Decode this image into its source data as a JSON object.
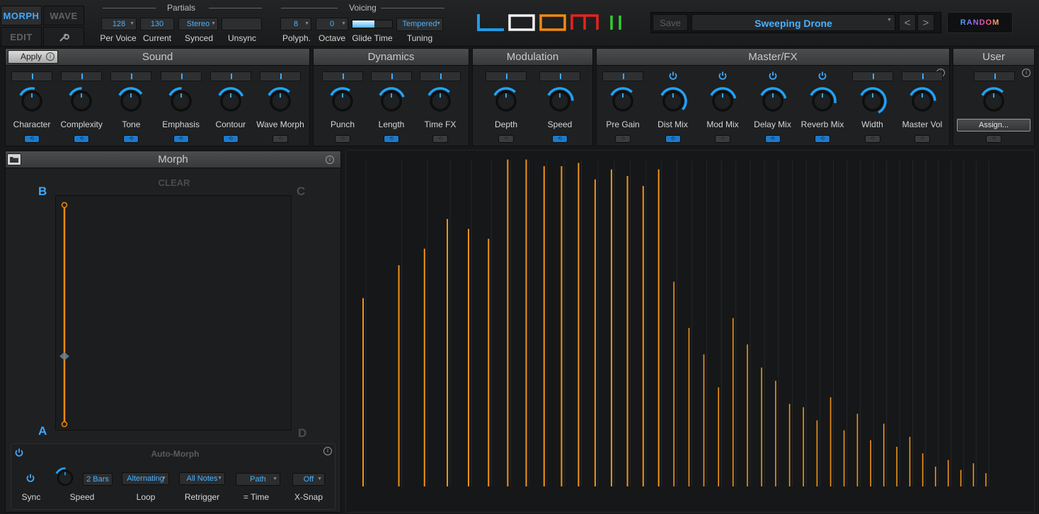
{
  "modes": {
    "morph": "MORPH",
    "wave": "WAVE",
    "edit": "EDIT"
  },
  "partials": {
    "title": "Partials",
    "per_voice": {
      "value": "128",
      "label": "Per Voice"
    },
    "current": {
      "value": "130",
      "label": "Current"
    },
    "synced": {
      "value": "Stereo",
      "label": "Synced"
    },
    "unsync": {
      "label": "Unsync"
    }
  },
  "voicing": {
    "title": "Voicing",
    "polyph": {
      "value": "8",
      "label": "Polyph."
    },
    "octave": {
      "value": "0",
      "label": "Octave"
    },
    "glide": {
      "label": "Glide Time",
      "level": 0.55
    },
    "tuning": {
      "value": "Tempered",
      "label": "Tuning"
    }
  },
  "logo": {
    "colors": [
      "#1e9be6",
      "#f2f2f2",
      "#f08a10",
      "#e8231e",
      "#33cc33"
    ]
  },
  "preset": {
    "save": "Save",
    "name": "Sweeping Drone",
    "prev": "<",
    "next": ">"
  },
  "random": {
    "label": "RANDOM"
  },
  "sound": {
    "title": "Sound",
    "apply": "Apply",
    "knobs": [
      {
        "label": "Character",
        "value": 0.35,
        "active": true
      },
      {
        "label": "Complexity",
        "value": 0.3,
        "active": true
      },
      {
        "label": "Tone",
        "value": 0.55,
        "active": true
      },
      {
        "label": "Emphasis",
        "value": 0.3,
        "active": true
      },
      {
        "label": "Contour",
        "value": 0.6,
        "active": true
      },
      {
        "label": "Wave Morph",
        "value": 0.5,
        "active": false
      }
    ]
  },
  "dynamics": {
    "title": "Dynamics",
    "knobs": [
      {
        "label": "Punch",
        "value": 0.45,
        "active": false
      },
      {
        "label": "Length",
        "value": 0.62,
        "active": true
      },
      {
        "label": "Time FX",
        "value": 0.5,
        "active": false
      }
    ]
  },
  "modulation": {
    "title": "Modulation",
    "knobs": [
      {
        "label": "Depth",
        "value": 0.5,
        "active": false
      },
      {
        "label": "Speed",
        "value": 0.7,
        "active": true
      }
    ]
  },
  "master": {
    "title": "Master/FX",
    "knobs": [
      {
        "label": "Pre Gain",
        "value": 0.5,
        "active": false,
        "power": false
      },
      {
        "label": "Dist Mix",
        "value": 0.9,
        "active": true,
        "power": true
      },
      {
        "label": "Mod Mix",
        "value": 0.65,
        "active": false,
        "power": true
      },
      {
        "label": "Delay Mix",
        "value": 0.65,
        "active": true,
        "power": true
      },
      {
        "label": "Reverb Mix",
        "value": 0.75,
        "active": true,
        "power": true
      },
      {
        "label": "Width",
        "value": 1.0,
        "active": false,
        "power": false
      },
      {
        "label": "Master Vol",
        "value": 0.7,
        "active": false,
        "power": false
      }
    ]
  },
  "user": {
    "title": "User",
    "assign": "Assign...",
    "value": 0.5
  },
  "morph": {
    "title": "Morph",
    "clear": "CLEAR",
    "corners": {
      "a": "A",
      "b": "B",
      "c": "C",
      "d": "D"
    },
    "path_position": 0.31
  },
  "automorph": {
    "title": "Auto-Morph",
    "sync": "Sync",
    "speed_value": "2 Bars",
    "speed_label": "Speed",
    "loop_value": "Alternating",
    "loop_label": "Loop",
    "retrigger_value": "All Notes",
    "retrigger_label": "Retrigger",
    "time_value": "Path",
    "time_label": "= Time",
    "xsnap_value": "Off",
    "xsnap_label": "X-Snap"
  },
  "spectrum": {
    "partials": [
      {
        "h": 0.57,
        "c": "o"
      },
      {
        "h": 0.67,
        "c": "o"
      },
      {
        "h": 0.72,
        "c": "o"
      },
      {
        "h": 0.81,
        "c": "o"
      },
      {
        "h": 0.78,
        "c": "o"
      },
      {
        "h": 0.75,
        "c": "o"
      },
      {
        "h": 0.99,
        "c": "o"
      },
      {
        "h": 0.99,
        "c": "o"
      },
      {
        "h": 0.97,
        "c": "o"
      },
      {
        "h": 0.97,
        "c": "o"
      },
      {
        "h": 0.98,
        "c": "o"
      },
      {
        "h": 0.93,
        "c": "o"
      },
      {
        "h": 0.96,
        "c": "o"
      },
      {
        "h": 0.94,
        "c": "o"
      },
      {
        "h": 0.91,
        "c": "o"
      },
      {
        "h": 0.96,
        "c": "o"
      },
      {
        "h": 0.62,
        "c": "o"
      },
      {
        "h": 0.48,
        "c": "o"
      },
      {
        "h": 0.4,
        "c": "o"
      },
      {
        "h": 0.3,
        "c": "o"
      },
      {
        "h": 0.51,
        "c": "o"
      },
      {
        "h": 0.43,
        "c": "o"
      },
      {
        "h": 0.36,
        "c": "o"
      },
      {
        "h": 0.32,
        "c": "o"
      },
      {
        "h": 0.25,
        "c": "o"
      },
      {
        "h": 0.24,
        "c": "o"
      },
      {
        "h": 0.2,
        "c": "o"
      },
      {
        "h": 0.27,
        "c": "o"
      },
      {
        "h": 0.17,
        "c": "o"
      },
      {
        "h": 0.22,
        "c": "o"
      },
      {
        "h": 0.14,
        "c": "o"
      },
      {
        "h": 0.19,
        "c": "o"
      },
      {
        "h": 0.12,
        "c": "o"
      },
      {
        "h": 0.15,
        "c": "o"
      },
      {
        "h": 0.1,
        "c": "o"
      },
      {
        "h": 0.06,
        "c": "o"
      },
      {
        "h": 0.08,
        "c": "o"
      },
      {
        "h": 0.05,
        "c": "o"
      },
      {
        "h": 0.07,
        "c": "o"
      },
      {
        "h": 0.04,
        "c": "o"
      }
    ]
  }
}
